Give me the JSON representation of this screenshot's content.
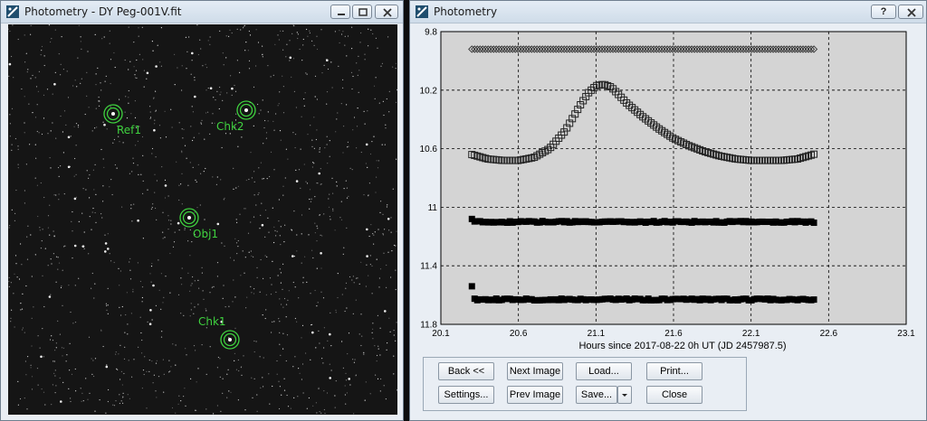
{
  "left_window": {
    "title": "Photometry - DY Peg-001V.fit",
    "stars": [
      {
        "label": "Ref1"
      },
      {
        "label": "Chk2"
      },
      {
        "label": "Obj1"
      },
      {
        "label": "Chk1"
      }
    ],
    "colors": {
      "marker": "#3fd23f",
      "background": "#151515"
    }
  },
  "right_window": {
    "title": "Photometry",
    "help_glyph": "?",
    "buttons": {
      "back": "Back <<",
      "next_image": "Next Image",
      "load": "Load...",
      "print": "Print...",
      "settings": "Settings...",
      "prev_image": "Prev Image",
      "save": "Save...",
      "close": "Close"
    }
  },
  "chart_data": {
    "type": "scatter",
    "title": "",
    "xlabel": "Hours since 2017-08-22 0h UT (JD 2457987.5)",
    "ylabel": "",
    "xlim": [
      20.1,
      23.1
    ],
    "ylim": [
      9.8,
      11.8
    ],
    "y_inverted": true,
    "x_ticks": [
      "20.1",
      "20.6",
      "21.1",
      "21.6",
      "22.1",
      "22.6",
      "23.1"
    ],
    "y_ticks": [
      "9.8",
      "10.2",
      "10.6",
      "11",
      "11.4",
      "11.8"
    ],
    "grid": true,
    "plot_background": "#d4d4d4",
    "series": [
      {
        "marker": "diamond-open",
        "x_start": 20.3,
        "x_end": 22.52,
        "values": [
          9.92,
          9.92
        ]
      },
      {
        "marker": "square-open",
        "x": [
          20.3,
          20.4,
          20.5,
          20.6,
          20.7,
          20.8,
          20.9,
          21.0,
          21.05,
          21.1,
          21.15,
          21.2,
          21.3,
          21.4,
          21.5,
          21.6,
          21.7,
          21.8,
          21.9,
          22.0,
          22.1,
          22.2,
          22.3,
          22.4,
          22.5,
          22.52
        ],
        "values": [
          10.64,
          10.67,
          10.68,
          10.68,
          10.66,
          10.6,
          10.48,
          10.3,
          10.22,
          10.17,
          10.16,
          10.18,
          10.29,
          10.38,
          10.46,
          10.53,
          10.58,
          10.62,
          10.65,
          10.67,
          10.68,
          10.68,
          10.68,
          10.67,
          10.64,
          10.63
        ]
      },
      {
        "marker": "square-filled",
        "x_start": 20.3,
        "x_end": 22.52,
        "values": [
          11.08,
          11.1
        ]
      },
      {
        "marker": "square-filled",
        "x_start": 20.3,
        "x_end": 22.52,
        "values": [
          11.54,
          11.63
        ]
      }
    ]
  }
}
